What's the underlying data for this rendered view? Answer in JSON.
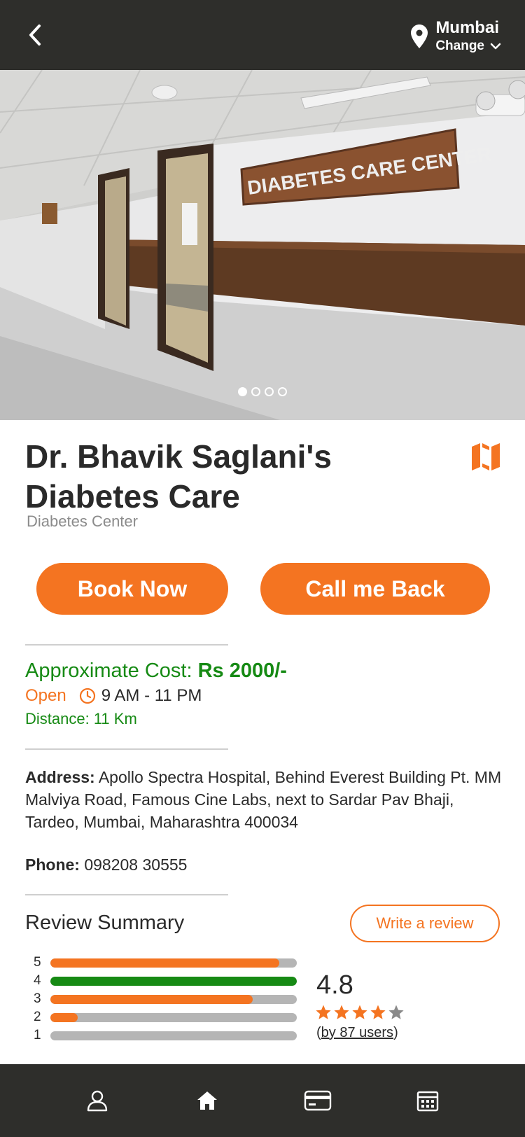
{
  "header": {
    "city": "Mumbai",
    "change_label": "Change"
  },
  "hero": {
    "sign_text": "DIABETES CARE CENTER",
    "slide_count": 4,
    "active_slide": 1
  },
  "clinic": {
    "name": "Dr. Bhavik Saglani's Diabetes Care",
    "category": "Diabetes Center"
  },
  "actions": {
    "book_label": "Book Now",
    "callback_label": "Call me Back"
  },
  "info": {
    "cost_label": "Approximate Cost:",
    "cost_value": "Rs 2000/-",
    "status": "Open",
    "hours": "9 AM - 11 PM",
    "distance": "Distance: 11 Km"
  },
  "contact": {
    "address_label": "Address:",
    "address_value": "Apollo Spectra Hospital, Behind Everest Building Pt. MM Malviya Road, Famous Cine Labs, next to Sardar Pav Bhaji, Tardeo, Mumbai, Maharashtra 400034",
    "phone_label": "Phone:",
    "phone_value": "098208 30555"
  },
  "reviews": {
    "title": "Review Summary",
    "write_label": "Write a review",
    "rating": "4.8",
    "stars_filled": 4,
    "stars_total": 5,
    "by_users": "by 87 users",
    "distribution": [
      {
        "label": "5",
        "fraction": 0.93,
        "color": "#f47421"
      },
      {
        "label": "4",
        "fraction": 1.0,
        "color": "#168a14"
      },
      {
        "label": "3",
        "fraction": 0.82,
        "color": "#f47421"
      },
      {
        "label": "2",
        "fraction": 0.11,
        "color": "#f47421"
      },
      {
        "label": "1",
        "fraction": 0.0,
        "color": "#f47421"
      }
    ]
  },
  "nav": {
    "items": [
      {
        "icon": "profile-icon"
      },
      {
        "icon": "home-icon"
      },
      {
        "icon": "card-icon"
      },
      {
        "icon": "calendar-icon"
      }
    ]
  },
  "colors": {
    "accent": "#f47421",
    "success": "#168a14",
    "bar": "#2e2e2b"
  }
}
